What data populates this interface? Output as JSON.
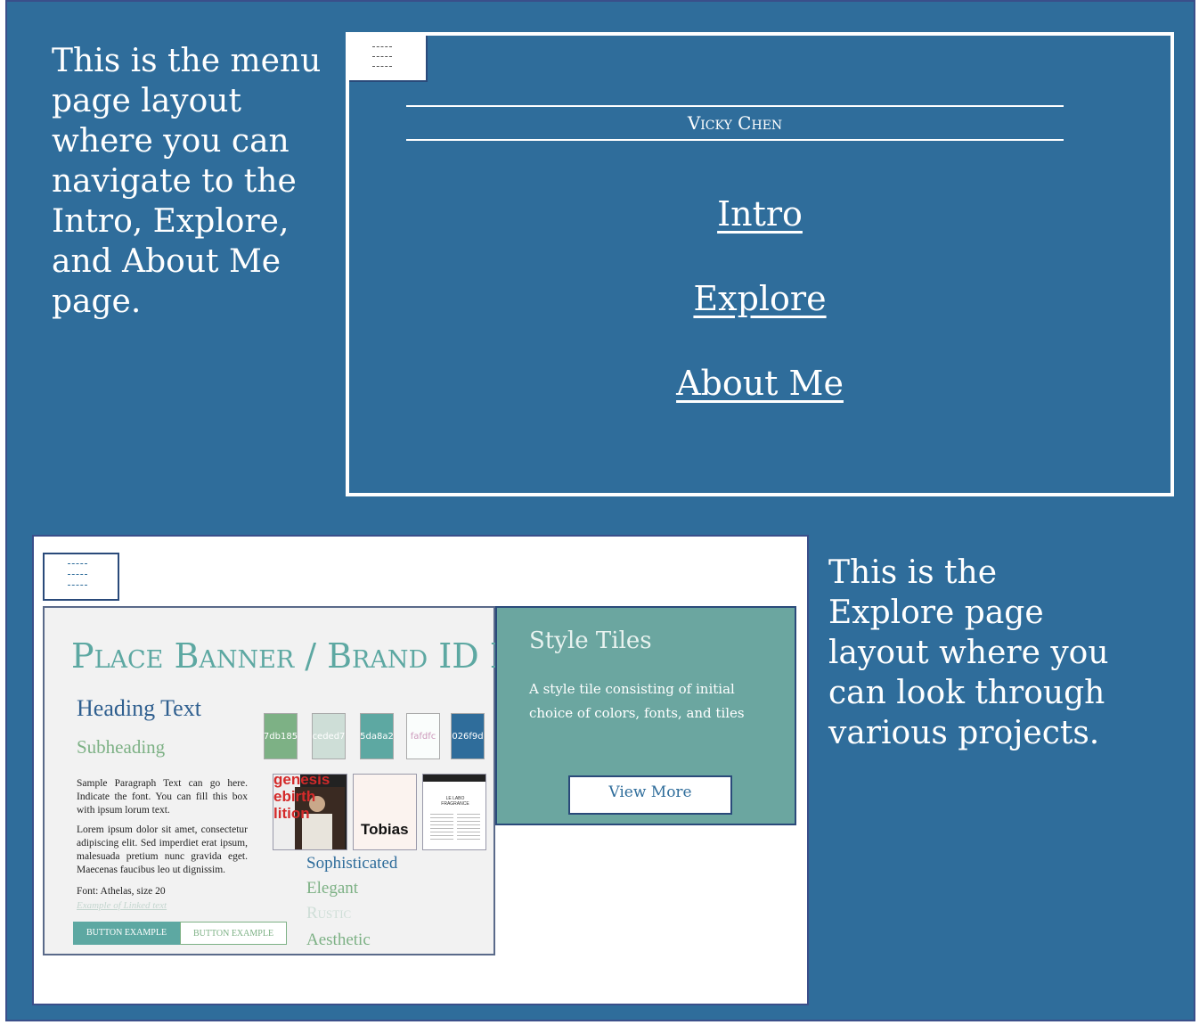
{
  "captions": {
    "menu": "This is the menu page layout where you can navigate to the Intro, Explore, and About Me page.",
    "explore": "This is the Explore page layout where you can look through various projects."
  },
  "menu_page": {
    "site_name": "Vicky Chen",
    "links": [
      "Intro",
      "Explore",
      "About Me"
    ],
    "menu_icon": "hamburger-menu-icon"
  },
  "explore_page": {
    "menu_icon": "hamburger-menu-icon",
    "style_tile": {
      "brand": "Place Banner / Brand ID Here",
      "heading": "Heading Text",
      "subheading": "Subheading",
      "paragraph1": "Sample Paragraph Text can go here. Indicate the font. You can fill this box with ipsum lorum text.",
      "paragraph2": "Lorem ipsum dolor sit amet, consectetur adipiscing elit. Sed imperdiet erat ipsum, malesuada pretium nunc gravida eget. Maecenas faucibus leo ut dignissim.",
      "font_line": "Font: Athelas, size 20",
      "linked_text": "Example of Linked text",
      "button1": "BUTTON EXAMPLE",
      "button2": "BUTTON EXAMPLE",
      "swatches": [
        {
          "label": "7db185",
          "color": "#7db185"
        },
        {
          "label": "ceded7",
          "color": "#ceded7"
        },
        {
          "label": "5da8a2",
          "color": "#5da8a2"
        },
        {
          "label": "fafdfc",
          "color": "#fafdfc"
        },
        {
          "label": "026f9d",
          "color": "#2f6d9b"
        }
      ],
      "thumb1_text": "genesis ebirth lition",
      "thumb2_text": "Tobias",
      "thumb3_text": "LE LABO FRAGRANCE",
      "adjectives": [
        "Sophisticated",
        "Elegant",
        "Rustic",
        "Aesthetic"
      ]
    },
    "side_panel": {
      "title": "Style Tiles",
      "description": "A style tile consisting of initial choice of colors, fonts, and tiles",
      "button": "View More"
    }
  },
  "colors": {
    "background": "#2f6d9b",
    "accent_teal": "#5da8a2",
    "accent_green": "#7db185"
  }
}
